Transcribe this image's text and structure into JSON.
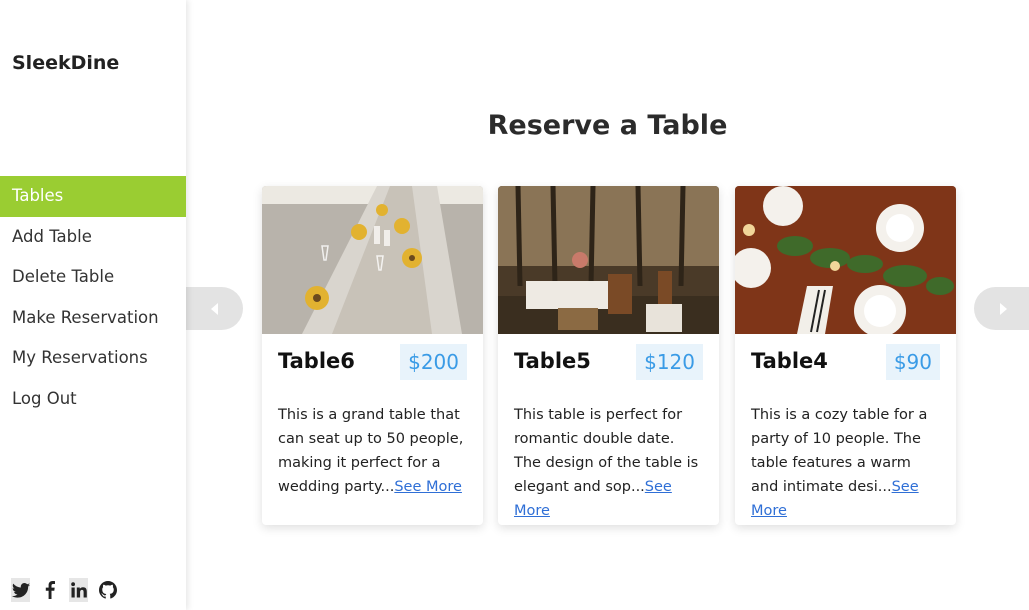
{
  "brand": "SleekDine",
  "nav": [
    {
      "label": "Tables",
      "active": true
    },
    {
      "label": "Add Table",
      "active": false
    },
    {
      "label": "Delete Table",
      "active": false
    },
    {
      "label": "Make Reservation",
      "active": false
    },
    {
      "label": "My Reservations",
      "active": false
    },
    {
      "label": "Log Out",
      "active": false
    }
  ],
  "social": [
    "twitter-icon",
    "facebook-icon",
    "linkedin-icon",
    "github-icon"
  ],
  "page_title": "Reserve a Table",
  "cards": [
    {
      "name": "Table6",
      "price": "$200",
      "desc": "This is a grand table that can seat up to 50 people, making it perfect for a wedding party...",
      "link": "See More"
    },
    {
      "name": "Table5",
      "price": "$120",
      "desc": "This table is perfect for romantic double date. The design of the table is elegant and sop...",
      "link": "See More"
    },
    {
      "name": "Table4",
      "price": "$90",
      "desc": "This is a cozy table for a party of 10 people. The table features a warm and intimate desi...",
      "link": "See More"
    }
  ],
  "colors": {
    "accent": "#9acd32",
    "price_text": "#3a9be6",
    "price_bg": "#e8f3fb"
  }
}
